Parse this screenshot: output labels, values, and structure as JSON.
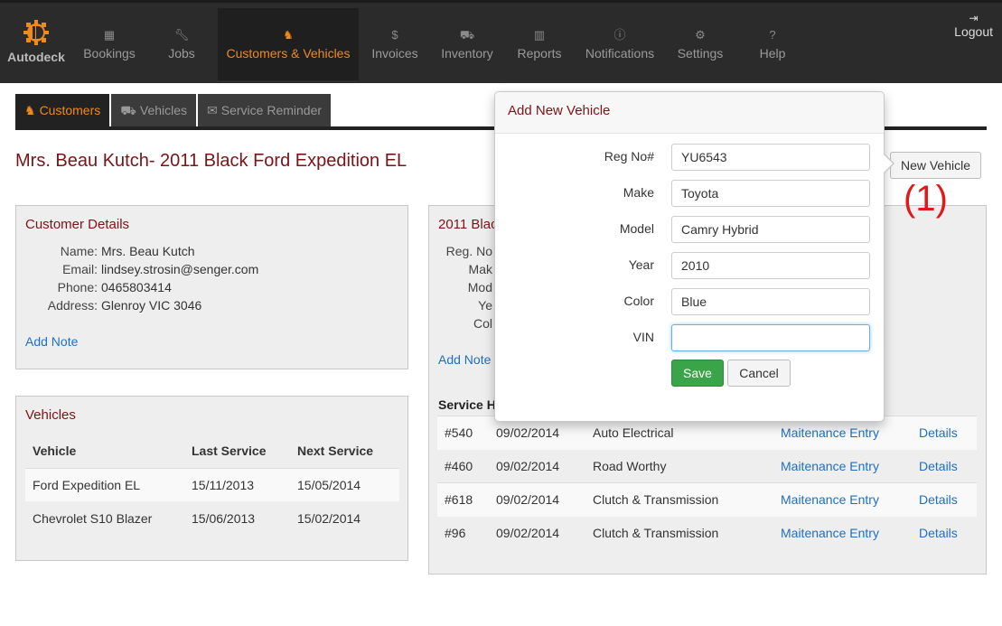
{
  "nav": {
    "brand": "Autodeck",
    "items": [
      {
        "label": "Bookings",
        "icon": "calendar-icon"
      },
      {
        "label": "Jobs",
        "icon": "wrench-icon"
      },
      {
        "label": "Customers & Vehicles",
        "icon": "users-icon"
      },
      {
        "label": "Invoices",
        "icon": "dollar-icon"
      },
      {
        "label": "Inventory",
        "icon": "truck-icon"
      },
      {
        "label": "Reports",
        "icon": "chart-icon"
      },
      {
        "label": "Notifications",
        "icon": "info-icon"
      },
      {
        "label": "Settings",
        "icon": "cogs-icon"
      },
      {
        "label": "Help",
        "icon": "question-icon"
      }
    ],
    "logout": "Logout",
    "active_color": "#f08a1c"
  },
  "subtabs": [
    {
      "label": "Customers",
      "icon": "users-icon"
    },
    {
      "label": "Vehicles",
      "icon": "truck-icon"
    },
    {
      "label": "Service Reminder",
      "icon": "envelope-icon"
    }
  ],
  "page_title": "Mrs. Beau Kutch- 2011 Black Ford Expedition EL",
  "customer": {
    "title": "Customer Details",
    "name_label": "Name:",
    "name": "Mrs. Beau Kutch",
    "email_label": "Email:",
    "email": "lindsey.strosin@senger.com",
    "phone_label": "Phone:",
    "phone": "0465803414",
    "address_label": "Address:",
    "address": "Glenroy VIC 3046",
    "add_note": "Add Note"
  },
  "vehicles": {
    "title": "Vehicles",
    "headers": [
      "Vehicle",
      "Last Service",
      "Next Service"
    ],
    "rows": [
      [
        "Ford Expedition EL",
        "15/11/2013",
        "15/05/2014"
      ],
      [
        "Chevrolet S10 Blazer",
        "15/06/2013",
        "15/02/2014"
      ]
    ]
  },
  "car": {
    "title_partial": "2011 Blac",
    "labels": [
      "Reg. No",
      "Mak",
      "Mod",
      "Ye",
      "Col"
    ],
    "add_note": "Add Note",
    "service_title_partial": "Service H",
    "service_rows": [
      [
        "#540",
        "09/02/2014",
        "Auto Electrical",
        "Maitenance Entry",
        "Details"
      ],
      [
        "#460",
        "09/02/2014",
        "Road Worthy",
        "Maitenance Entry",
        "Details"
      ],
      [
        "#618",
        "09/02/2014",
        "Clutch & Transmission",
        "Maitenance Entry",
        "Details"
      ],
      [
        "#96",
        "09/02/2014",
        "Clutch & Transmission",
        "Maitenance Entry",
        "Details"
      ]
    ]
  },
  "new_vehicle_button": "New Vehicle",
  "annotation": "(1)",
  "modal": {
    "title": "Add New Vehicle",
    "fields": [
      {
        "label": "Reg No#",
        "value": "YU6543"
      },
      {
        "label": "Make",
        "value": "Toyota"
      },
      {
        "label": "Model",
        "value": "Camry Hybrid"
      },
      {
        "label": "Year",
        "value": "2010"
      },
      {
        "label": "Color",
        "value": "Blue"
      },
      {
        "label": "VIN",
        "value": ""
      }
    ],
    "save": "Save",
    "cancel": "Cancel"
  }
}
